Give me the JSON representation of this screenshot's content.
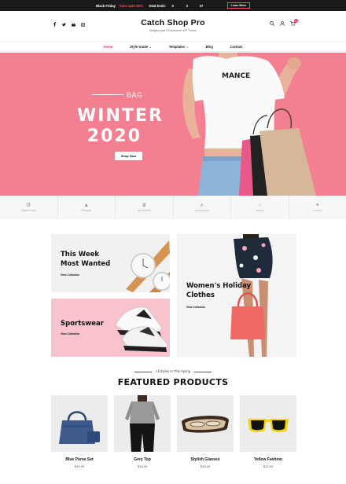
{
  "topbar": {
    "promo_a": "Black Friday",
    "promo_b": "Save upto 50%",
    "deal_label": "Deal Ends:",
    "countdown": [
      "0",
      "3",
      "37",
      ""
    ],
    "learn_more": "Learn More"
  },
  "header": {
    "site_title": "Catch Shop Pro",
    "tagline": "Multipurpose ECommerce WP Theme",
    "cart_count": "0",
    "social_icons": [
      "facebook-icon",
      "twitter-icon",
      "youtube-icon",
      "instagram-icon"
    ]
  },
  "nav": {
    "items": [
      {
        "label": "Home",
        "active": true
      },
      {
        "label": "Style Guide",
        "dropdown": true
      },
      {
        "label": "Templates",
        "dropdown": true
      },
      {
        "label": "Blog"
      },
      {
        "label": "Contact"
      }
    ]
  },
  "hero": {
    "subtitle": "BAG",
    "title_line1": "WINTER",
    "title_line2": "2020",
    "button": "Shop Now",
    "shirt_text": "MANCE",
    "background_color": "#f47f90"
  },
  "brands": [
    {
      "name": "Digital Code",
      "icon": "gear-logo-icon"
    },
    {
      "name": "Pinnacle",
      "icon": "mountain-logo-icon"
    },
    {
      "name": "Wonderfolk",
      "icon": "crown-logo-icon"
    },
    {
      "name": "Accessories",
      "icon": "hanger-logo-icon"
    },
    {
      "name": "Jewelry",
      "icon": "ring-logo-icon"
    },
    {
      "name": "Luxury",
      "icon": "luxury-logo-icon"
    }
  ],
  "collections": [
    {
      "title_line1": "This Week",
      "title_line2": "Most Wanted",
      "link": "View Collection"
    },
    {
      "title_line1": "Women's Holiday",
      "title_line2": "Clothes",
      "link": "View Collection"
    },
    {
      "title_line1": "Sportswear",
      "title_line2": "",
      "link": "View Collection"
    }
  ],
  "featured": {
    "subtitle": "All Styles In This Spring",
    "title": "FEATURED PRODUCTS",
    "products": [
      {
        "name": "Blue Purse Set",
        "price": "$29.99"
      },
      {
        "name": "Grey Top",
        "price": "$15.00"
      },
      {
        "name": "Stylish Glasses",
        "price": "$35.00"
      },
      {
        "name": "Yellow Fashion",
        "price": "$12.00"
      }
    ]
  },
  "colors": {
    "accent": "#ff3366",
    "hero_pink": "#f47f90",
    "sportswear_pink": "#f8c3cc",
    "topbar": "#1a1a1a"
  }
}
